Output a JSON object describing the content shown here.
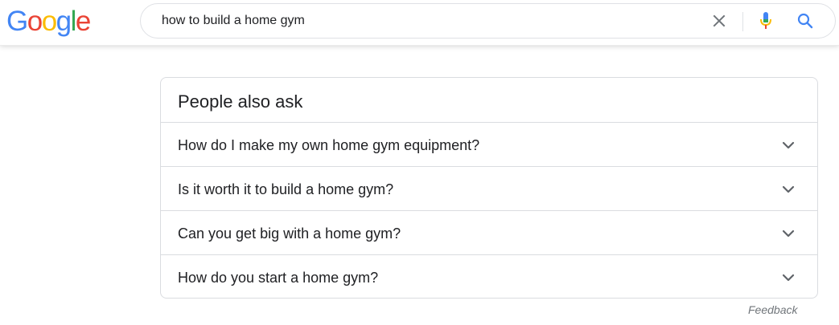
{
  "logo": {
    "letters": [
      "G",
      "o",
      "o",
      "g",
      "l",
      "e"
    ],
    "colors": [
      "#4285F4",
      "#EA4335",
      "#FBBC05",
      "#4285F4",
      "#34A853",
      "#EA4335"
    ]
  },
  "search": {
    "query": "how to build a home gym",
    "clear_icon": "close-icon",
    "mic_icon": "microphone-icon",
    "search_icon": "search-icon"
  },
  "paa": {
    "title": "People also ask",
    "questions": [
      "How do I make my own home gym equipment?",
      "Is it worth it to build a home gym?",
      "Can you get big with a home gym?",
      "How do you start a home gym?"
    ],
    "expand_icon": "chevron-down-icon"
  },
  "feedback_label": "Feedback",
  "colors": {
    "text": "#202124",
    "border": "#dadce0",
    "muted": "#70757a",
    "icon_blue": "#4285F4"
  }
}
